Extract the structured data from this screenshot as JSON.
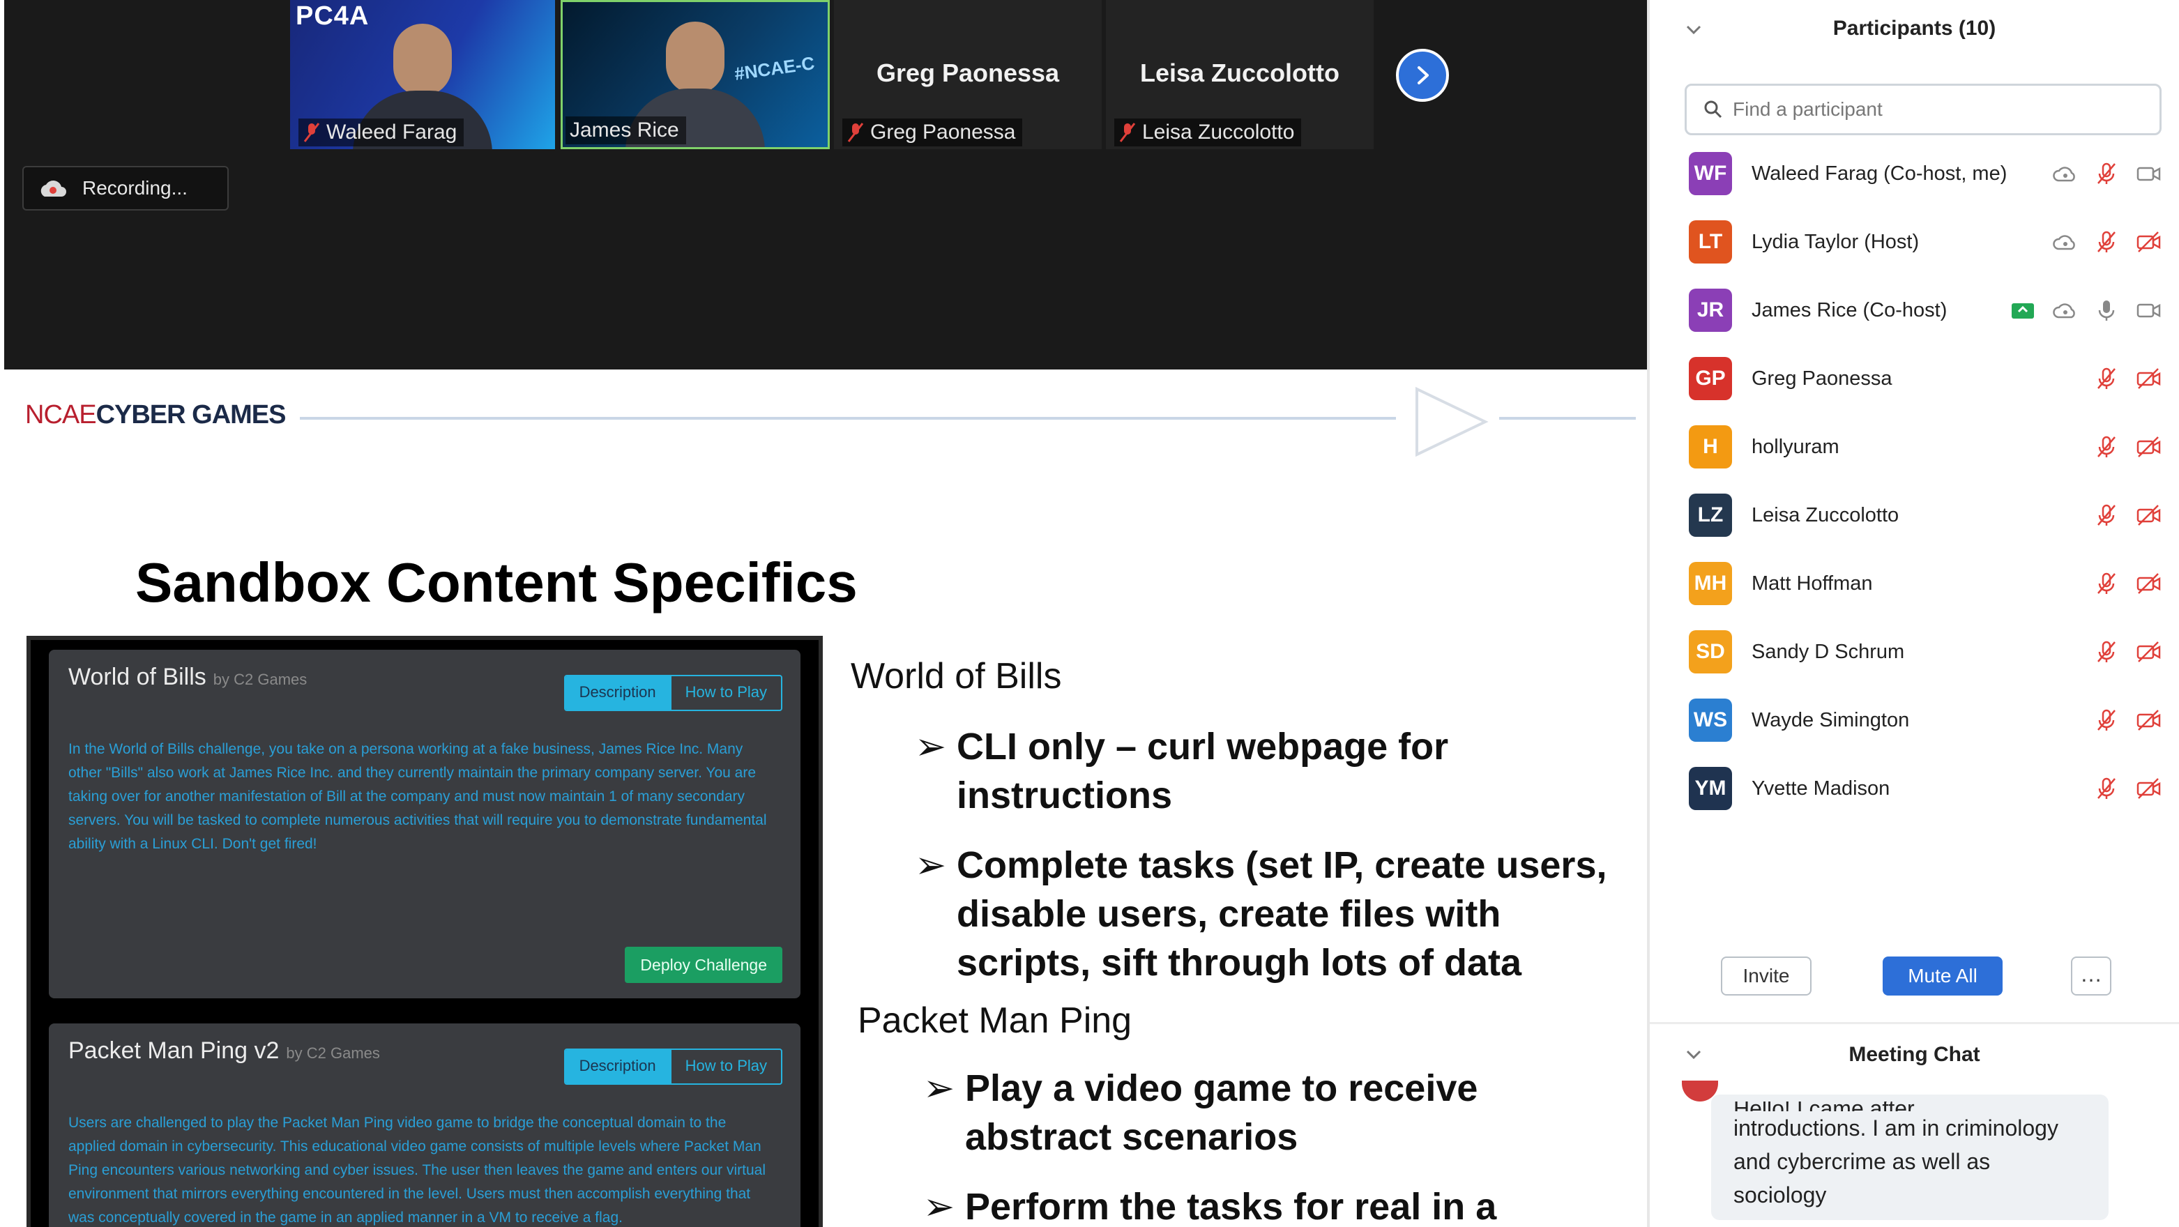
{
  "meeting": {
    "recording_label": "Recording...",
    "tiles": [
      {
        "name": "Waleed Farag",
        "muted": true
      },
      {
        "name": "James Rice",
        "muted": false
      },
      {
        "name": "Greg Paonessa",
        "muted": true
      },
      {
        "name": "Leisa Zuccolotto",
        "muted": true
      }
    ],
    "waleed_bg_text": "PC4A",
    "james_bg_text": "#NCAE-C"
  },
  "slide": {
    "brand_ncae": "NCAE",
    "brand_cyber": "CYBER GAMES",
    "title": "Sandbox Content Specifics",
    "cards": [
      {
        "title": "World of Bills",
        "by": "by C2 Games",
        "tab_description": "Description",
        "tab_howto": "How to Play",
        "body": "In the World of Bills challenge, you take on a persona working at a fake business, James Rice Inc. Many other \"Bills\" also work at James Rice Inc. and they currently maintain the primary company server. You are taking over for another manifestation of Bill at the company and must now maintain 1 of many secondary servers. You will be tasked to complete numerous activities that will require you to demonstrate fundamental ability with a Linux CLI. Don't get fired!",
        "deploy_label": "Deploy Challenge"
      },
      {
        "title": "Packet Man Ping v2",
        "by": "by C2 Games",
        "tab_description": "Description",
        "tab_howto": "How to Play",
        "body": "Users are challenged to play the Packet Man Ping video game to bridge the conceptual domain to the applied domain in cybersecurity. This educational video game consists of multiple levels where Packet Man Ping encounters various networking and cyber issues. The user then leaves the game and enters our virtual environment that mirrors everything encountered in the level. Users must then accomplish everything that was conceptually covered in the game in an applied manner in a VM to receive a flag."
      }
    ],
    "section1_heading": "World of Bills",
    "section1_bullets": [
      "CLI only – curl webpage for instructions",
      "Complete tasks (set IP, create users, disable users, create files with scripts, sift through lots of data"
    ],
    "section2_heading": "Packet Man Ping",
    "section2_bullets": [
      "Play a video game to receive abstract scenarios",
      "Perform the tasks for real in a"
    ]
  },
  "participants": {
    "title": "Participants (10)",
    "search_placeholder": "Find a participant",
    "list": [
      {
        "initials": "WF",
        "name": "Waleed Farag (Co-host, me)",
        "color": "#8b3fb6",
        "icons": [
          "cloud",
          "mic-off",
          "video"
        ]
      },
      {
        "initials": "LT",
        "name": "Lydia Taylor (Host)",
        "color": "#e0541f",
        "icons": [
          "cloud",
          "mic-off",
          "video-off"
        ]
      },
      {
        "initials": "JR",
        "name": "James Rice (Co-host)",
        "color": "#8b3fb6",
        "icons": [
          "share",
          "cloud",
          "mic",
          "video"
        ]
      },
      {
        "initials": "GP",
        "name": "Greg Paonessa",
        "color": "#d7322b",
        "icons": [
          "mic-off",
          "video-off"
        ]
      },
      {
        "initials": "H",
        "name": "hollyuram",
        "color": "#f39a12",
        "icons": [
          "mic-off",
          "video-off"
        ]
      },
      {
        "initials": "LZ",
        "name": "Leisa Zuccolotto",
        "color": "#24384f",
        "icons": [
          "mic-off",
          "video-off"
        ]
      },
      {
        "initials": "MH",
        "name": "Matt Hoffman",
        "color": "#f3a11c",
        "icons": [
          "mic-off",
          "video-off"
        ]
      },
      {
        "initials": "SD",
        "name": "Sandy D Schrum",
        "color": "#f3a11c",
        "icons": [
          "mic-off",
          "video-off"
        ]
      },
      {
        "initials": "WS",
        "name": "Wayde Simington",
        "color": "#2b7fd1",
        "icons": [
          "mic-off",
          "video-off"
        ]
      },
      {
        "initials": "YM",
        "name": "Yvette Madison",
        "color": "#1f3350",
        "icons": [
          "mic-off",
          "video-off"
        ]
      }
    ],
    "invite_label": "Invite",
    "mute_all_label": "Mute All",
    "more_label": "…"
  },
  "chat": {
    "title": "Meeting Chat",
    "cut_line": "Hello! I came after",
    "message": "introductions.  I am in criminology and cybercrime as well as sociology"
  },
  "colors": {
    "zoom_blue": "#2d6fd8",
    "muted_red": "#e0403a",
    "card_blue_text": "#2a9fd6",
    "deploy_green": "#1b9e62"
  }
}
